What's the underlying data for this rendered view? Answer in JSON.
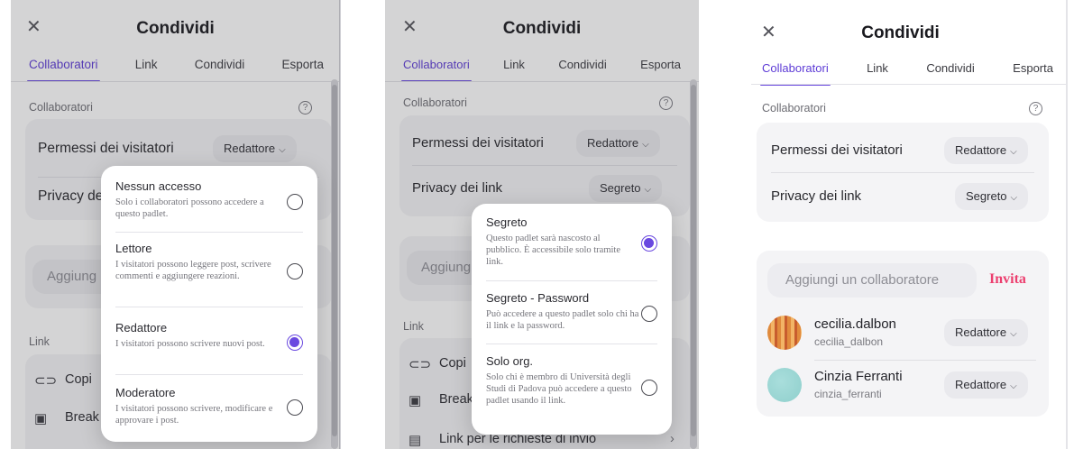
{
  "dialog": {
    "title": "Condividi",
    "close_icon": "close-icon",
    "tabs": [
      "Collaboratori",
      "Link",
      "Condividi",
      "Esporta"
    ],
    "active_tab": "Collaboratori"
  },
  "collaborators_section": {
    "label": "Collaboratori",
    "help_glyph": "?",
    "visitor_permissions_label": "Permessi dei visitatori",
    "visitor_permissions_value": "Redattore",
    "link_privacy_label": "Privacy dei link",
    "link_privacy_value": "Segreto",
    "link_privacy_truncated": "Privacy de"
  },
  "invite": {
    "placeholder": "Aggiungi un collaboratore",
    "placeholder_truncated": "Aggiung",
    "button": "Invita"
  },
  "link_section": {
    "label": "Link",
    "copy_truncated": "Copi",
    "break_truncated": "Break",
    "submission_link": "Link per le richieste di invio"
  },
  "permissions_menu": [
    {
      "title": "Nessun accesso",
      "desc": "Solo i collaboratori possono accedere a questo padlet.",
      "selected": false
    },
    {
      "title": "Lettore",
      "desc": "I visitatori possono leggere post, scrivere commenti e aggiungere reazioni.",
      "selected": false
    },
    {
      "title": "Redattore",
      "desc": "I visitatori possono scrivere nuovi post.",
      "selected": true
    },
    {
      "title": "Moderatore",
      "desc": "I visitatori possono scrivere, modificare e approvare i post.",
      "selected": false
    }
  ],
  "privacy_menu": [
    {
      "title": "Segreto",
      "desc": "Questo padlet sarà nascosto al pubblico. È accessibile solo tramite link.",
      "selected": true
    },
    {
      "title": "Segreto - Password",
      "desc": "Può accedere a questo padlet solo chi ha il link e la password.",
      "selected": false
    },
    {
      "title": "Solo org.",
      "desc": "Solo chi è membro di Università degli Studi di Padova può accedere a questo padlet usando il link.",
      "selected": false
    }
  ],
  "collaborators": [
    {
      "name": "cecilia.dalbon",
      "handle": "cecilia_dalbon",
      "role": "Redattore"
    },
    {
      "name": "Cinzia Ferranti",
      "handle": "cinzia_ferranti",
      "role": "Redattore"
    }
  ],
  "colors": {
    "accent": "#6a49e0",
    "invite": "#ec3f6f"
  }
}
